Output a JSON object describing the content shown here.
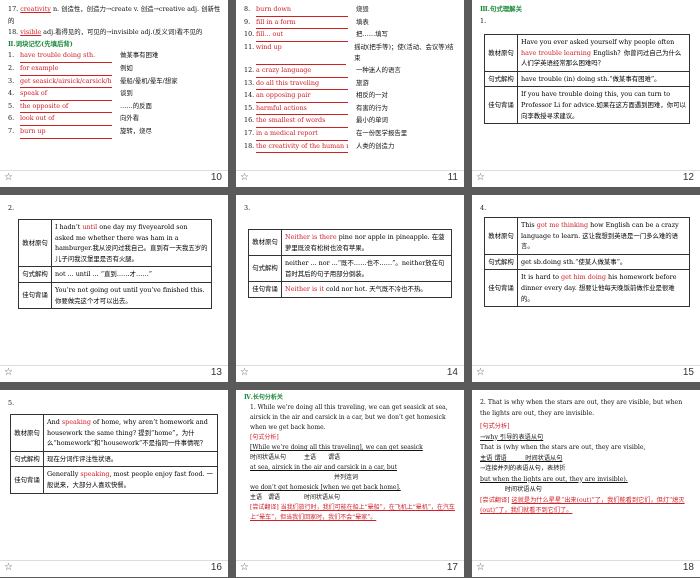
{
  "slides": [
    {
      "number": "10",
      "lines": [
        {
          "n": "17.",
          "ans": "creativity",
          "rest": "n. 创造性，创造力→create v. 创造→creative adj. 创新性的"
        },
        {
          "n": "18.",
          "ans": "visible",
          "rest": "adj.看得见的，可见的→invisible adj.(反义词)看不见的"
        }
      ],
      "section": "Ⅱ.词块记忆(先填后背)",
      "items": [
        {
          "n": "1.",
          "ans": "have trouble doing sth.",
          "cn": "做某事有困难"
        },
        {
          "n": "2.",
          "ans": "for example",
          "cn": "例如"
        },
        {
          "n": "3.",
          "ans": "get seasick/airsick/carsick/homesick",
          "cn": "晕船/晕机/晕车/想家"
        },
        {
          "n": "4.",
          "ans": "speak of",
          "cn": "谈到"
        },
        {
          "n": "5.",
          "ans": "the opposite of",
          "cn": "……的反面"
        },
        {
          "n": "6.",
          "ans": "look out of",
          "cn": "向外看"
        },
        {
          "n": "7.",
          "ans": "burn up",
          "cn": "旋转，烧尽"
        }
      ]
    },
    {
      "number": "11",
      "items": [
        {
          "n": "8.",
          "ans": "burn down",
          "cn": "烧毁"
        },
        {
          "n": "9.",
          "ans": "fill in a form",
          "cn": "填表"
        },
        {
          "n": "10.",
          "ans": "fill... out",
          "cn": "把……填写"
        },
        {
          "n": "11.",
          "ans": "wind up",
          "cn": "摇动(把手等)；使(活动、会议等)结束"
        },
        {
          "n": "12.",
          "ans": "a crazy language",
          "cn": "一种迷人的语言"
        },
        {
          "n": "13.",
          "ans": "do all this traveling",
          "cn": "旅游"
        },
        {
          "n": "14.",
          "ans": "an opposing pair",
          "cn": "相反的一对"
        },
        {
          "n": "15.",
          "ans": "harmful actions",
          "cn": "有害的行为"
        },
        {
          "n": "16.",
          "ans": "the smallest of words",
          "cn": "最小的单词"
        },
        {
          "n": "17.",
          "ans": "in a medical report",
          "cn": "在一份医学报告里"
        },
        {
          "n": "18.",
          "ans": "the creativity of the human race",
          "cn": "人类的创造力"
        }
      ]
    },
    {
      "number": "12",
      "section": "Ⅲ.句式理解关",
      "index": "1.",
      "rows": [
        {
          "label": "教材原句",
          "en": "Have you ever asked yourself why people often ",
          "hl": "have trouble learning",
          "en2": " English？你曾问过自己为什么人们学英语经常那么困难吗？"
        },
        {
          "label": "句式解构",
          "en": "have trouble (in) doing sth.“做某事有困难”。"
        },
        {
          "label": "佳句背诵",
          "en": "If you have trouble doing this, you can turn to Professor Li for advice.如果在这方面遇到困难，你可以向李教授寻求建议。"
        }
      ]
    },
    {
      "number": "13",
      "index": "2.",
      "rows": [
        {
          "label": "教材原句",
          "en": "I hadn’t ",
          "hl": "until",
          "en2": " one day my fiveyearold son asked me whether there was ham in a hamburger.我从没问过我自己。直到有一天我五岁的儿子问我汉堡里是否有火腿。"
        },
        {
          "label": "句式解构",
          "en": "not ... until ... “直到……才……”"
        },
        {
          "label": "佳句背诵",
          "en": "You’re not going out until you’ve finished this. 你要做完这个才可以出去。"
        }
      ]
    },
    {
      "number": "14",
      "index": "3.",
      "rows": [
        {
          "label": "教材原句",
          "hl": "Neither is there",
          "en": " pine nor apple in pineapple. 在菠萝里既没有松树也没有苹果。"
        },
        {
          "label": "句式解构",
          "en": "neither ... nor ...“既不……也不……”。neither放在句首时其后的句子用部分倒装。"
        },
        {
          "label": "佳句背诵",
          "hl": "Neither is it",
          "en": " cold nor hot. 天气既不冷也不热。"
        }
      ]
    },
    {
      "number": "15",
      "index": "4.",
      "rows": [
        {
          "label": "教材原句",
          "en": "This ",
          "hl": "got me thinking",
          "en2": " how English can be a crazy language to learn. 这让我想到英语是一门多么难的语言。"
        },
        {
          "label": "句式解构",
          "en": "get sb.doing sth.“使某人做某事”。"
        },
        {
          "label": "佳句背诵",
          "en": "It is hard to ",
          "hl": "get him doing",
          "en2": " his homework before dinner every day. 想要让他每天晚饭前做作业是很难的。"
        }
      ]
    },
    {
      "number": "16",
      "index": "5.",
      "rows": [
        {
          "label": "教材原句",
          "en": "And ",
          "hl": "speaking",
          "en2": " of home, why aren’t homework and housework the same thing? 提到“home”，为什么“homework”和“housework”不是指同一件事情呢？"
        },
        {
          "label": "句式解构",
          "en": "现在分词作评注性状语。"
        },
        {
          "label": "佳句背诵",
          "en": "Generally ",
          "hl": "speaking",
          "en2": ", most people enjoy fast food. 一般说来，大部分人喜欢快餐。"
        }
      ]
    },
    {
      "number": "17",
      "section": "Ⅳ.长句分析关",
      "para": "1. While we’re doing all this traveling, we can get seasick at sea, airsick in the air and carsick in a car, but we don’t get homesick when we get back home.",
      "analysis_label": "[句式分析]",
      "analysis": [
        "[While we’re doing all this traveling], we can get seasick",
        "时间状语从句　　　主语　　谓语",
        "at sea, airsick in the air and carsick in a car, but",
        "　　　　　　　　　　　　　　并列连词",
        "we don’t get homesick [when we get back home].",
        "主语　谓语　　　　时间状语从句"
      ],
      "trans_label": "[尝试翻译]",
      "trans": "当我们旅行时，我们可能在船上“晕船”，在飞机上“晕机”，在汽车上“晕车”，但当我们回家时，我们不会“晕家”。"
    },
    {
      "number": "18",
      "para": "2. That is why when the stars are out, they are visible, but when the lights are out, they are invisible.",
      "analysis_label": "[句式分析]",
      "analysis": [
        "→why 引导的表语从句",
        "That is (why when the stars are out, they are visible,",
        "主语 谓语　　　时间状语从句",
        "→连接并列的表语从句，表转折",
        "but when the lights are out, they are invisible).",
        "　　　　时间状语从句"
      ],
      "trans_label": "[尝试翻译]",
      "trans": "这就是为什么星星“出来(out)”了，我们能看到它们，但灯“熄灭(out)”了，我们就看不到它们了。"
    }
  ],
  "colors": {
    "answer": "#d0202a",
    "section": "#1d8a3a",
    "highlight": "#d0202a",
    "selection": "#f0a020"
  },
  "footer_icon": "star-icon"
}
